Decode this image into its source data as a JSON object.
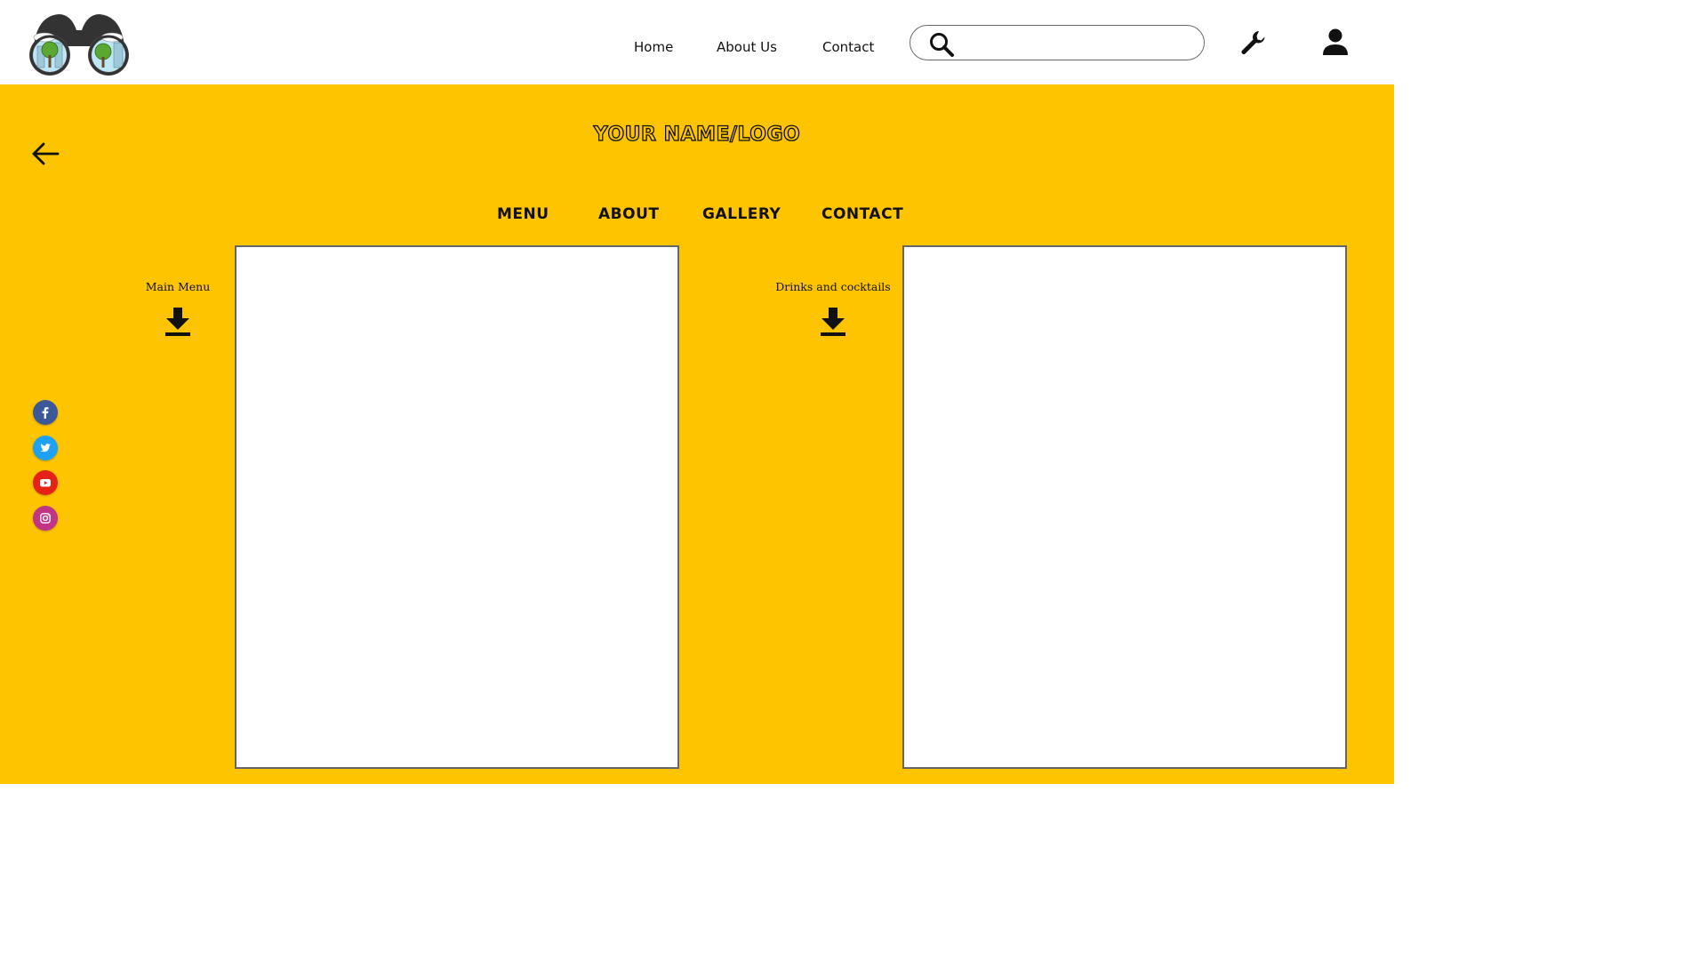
{
  "header": {
    "nav": [
      {
        "label": "Home"
      },
      {
        "label": "About Us"
      },
      {
        "label": "Contact"
      }
    ],
    "search": {
      "placeholder": "",
      "value": ""
    },
    "icons": {
      "logo": "binoculars-logo-icon",
      "search": "search-icon",
      "settings": "wrench-icon",
      "account": "user-icon"
    }
  },
  "main": {
    "background_color": "#ffc400",
    "back_icon": "arrow-left-icon",
    "title": "YOUR NAME/LOGO",
    "sections": [
      {
        "label": "MENU"
      },
      {
        "label": "ABOUT"
      },
      {
        "label": "GALLERY"
      },
      {
        "label": "CONTACT"
      }
    ],
    "downloads": [
      {
        "label": "Main Menu",
        "icon": "download-icon"
      },
      {
        "label": "Drinks and cocktails",
        "icon": "download-icon"
      }
    ],
    "social": [
      {
        "name": "facebook-icon",
        "color": "#3b5998"
      },
      {
        "name": "twitter-icon",
        "color": "#1da1f2"
      },
      {
        "name": "youtube-icon",
        "color": "#e62117"
      },
      {
        "name": "instagram-icon",
        "color": "#c13584"
      }
    ]
  }
}
